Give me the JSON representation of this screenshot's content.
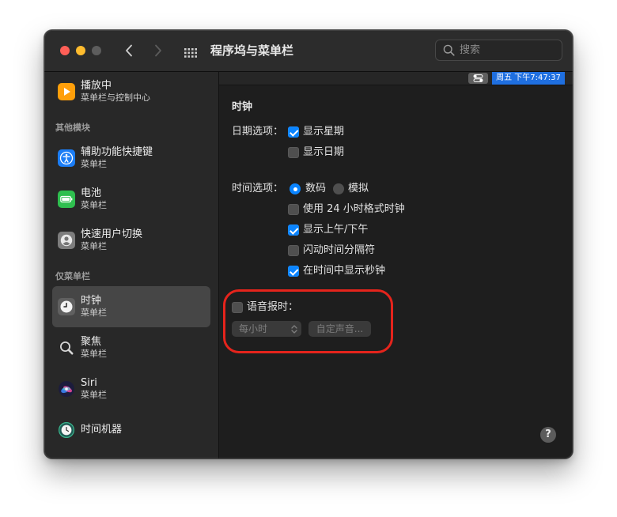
{
  "window": {
    "title": "程序坞与菜单栏"
  },
  "toolbar": {
    "search_placeholder": "搜索"
  },
  "colors": {
    "accent": "#0a84ff",
    "annotation": "#e5241c",
    "menubar_highlight": "#1f6fe0"
  },
  "menubar_preview": {
    "clock_text": "周五 下午7:47:37",
    "icons": [
      "control-center-icon"
    ]
  },
  "sidebar": {
    "top_item": {
      "title": "播放中",
      "subtitle": "菜单栏与控制中心",
      "icon": "play-icon"
    },
    "sections": [
      {
        "header": "其他模块",
        "items": [
          {
            "title": "辅助功能快捷键",
            "subtitle": "菜单栏",
            "icon": "accessibility-icon"
          },
          {
            "title": "电池",
            "subtitle": "菜单栏",
            "icon": "battery-icon"
          },
          {
            "title": "快速用户切换",
            "subtitle": "菜单栏",
            "icon": "user-switch-icon"
          }
        ]
      },
      {
        "header": "仅菜单栏",
        "items": [
          {
            "title": "时钟",
            "subtitle": "菜单栏",
            "icon": "clock-icon",
            "selected": true
          },
          {
            "title": "聚焦",
            "subtitle": "菜单栏",
            "icon": "spotlight-icon"
          },
          {
            "title": "Siri",
            "subtitle": "菜单栏",
            "icon": "siri-icon"
          },
          {
            "title": "时间机器",
            "icon": "time-machine-icon"
          }
        ]
      }
    ]
  },
  "clock": {
    "heading": "时钟",
    "date_options": {
      "label": "日期选项：",
      "show_weekday": {
        "label": "显示星期",
        "checked": true
      },
      "show_date": {
        "label": "显示日期",
        "checked": false
      }
    },
    "time_options": {
      "label": "时间选项：",
      "digital": {
        "label": "数码",
        "selected": true
      },
      "analog": {
        "label": "模拟",
        "selected": false
      },
      "use_24_hour": {
        "label": "使用 24 小时格式时钟",
        "checked": false
      },
      "show_am_pm": {
        "label": "显示上午/下午",
        "checked": true
      },
      "flash_separators": {
        "label": "闪动时间分隔符",
        "checked": false
      },
      "show_seconds": {
        "label": "在时间中显示秒钟",
        "checked": true
      }
    },
    "announce_time": {
      "label": "语音报时：",
      "checked": false,
      "interval": "每小时",
      "customize_voice_label": "自定声音..."
    }
  },
  "help": {
    "label": "?"
  }
}
